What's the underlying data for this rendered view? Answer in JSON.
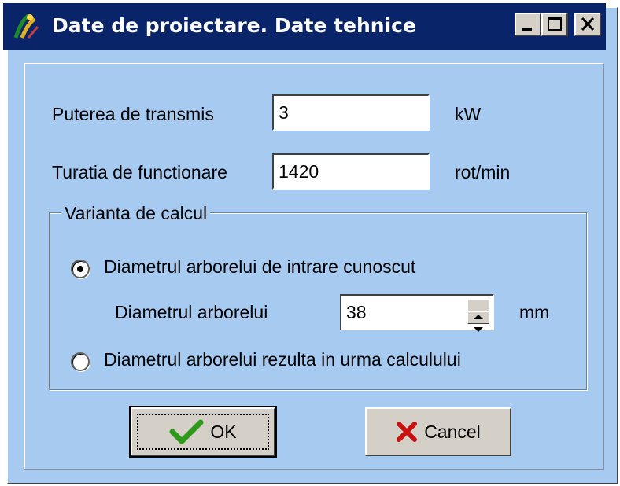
{
  "window": {
    "title": "Date de proiectare. Date tehnice",
    "controls": {
      "minimize": "_",
      "maximize": "□",
      "close": "✕"
    }
  },
  "fields": {
    "power": {
      "label": "Puterea de transmis",
      "value": "3",
      "unit": "kW"
    },
    "speed": {
      "label": "Turatia de functionare",
      "value": "1420",
      "unit": "rot/min"
    }
  },
  "calc_group": {
    "caption": "Varianta de calcul",
    "option_known": "Diametrul arborelui de intrare cunoscut",
    "diameter_label": "Diametrul arborelui",
    "diameter_value": "38",
    "diameter_unit": "mm",
    "option_computed": "Diametrul arborelui rezulta in urma calculului",
    "selected": "known"
  },
  "buttons": {
    "ok": "OK",
    "cancel": "Cancel"
  },
  "icons": {
    "app": "app-icon",
    "ok": "checkmark-icon",
    "cancel": "x-icon",
    "spin_up": "arrow-up-icon",
    "spin_down": "arrow-down-icon"
  },
  "colors": {
    "client_bg": "#a6caf0",
    "titlebar": "#0a246a",
    "check": "#2e9a18",
    "cross": "#c81010"
  }
}
